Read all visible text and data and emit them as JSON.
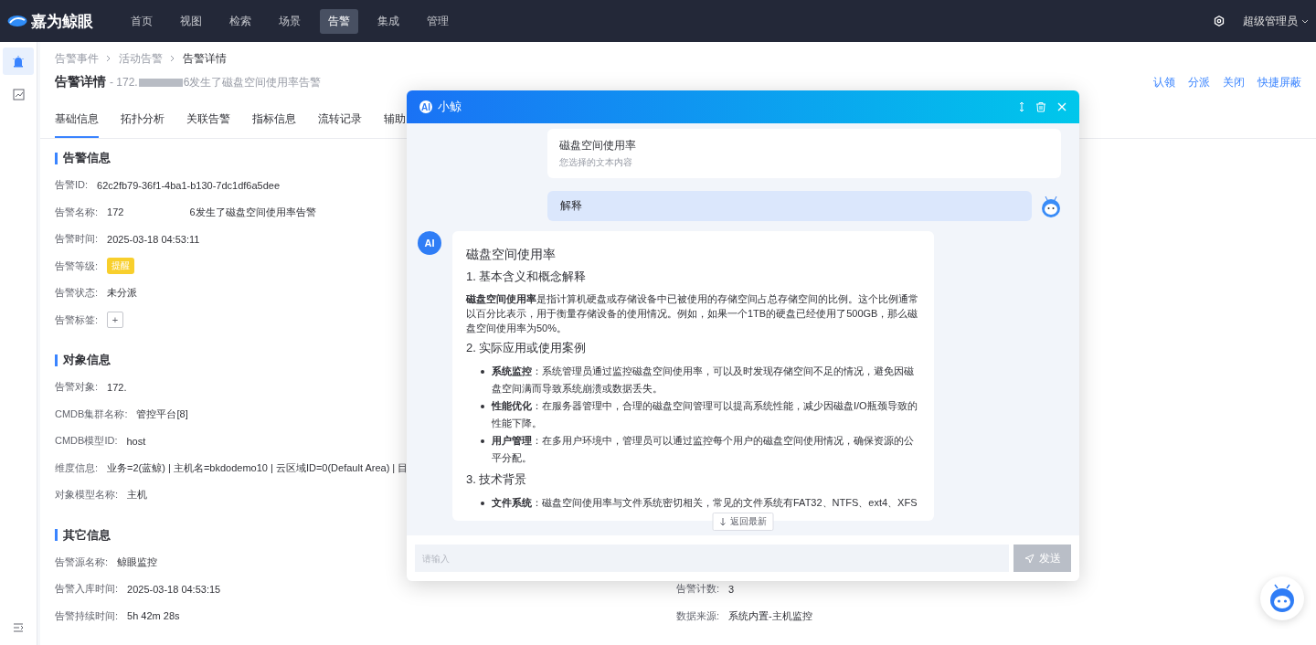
{
  "topbar": {
    "brand": "嘉为鲸眼",
    "nav": [
      {
        "label": "首页",
        "selected": false
      },
      {
        "label": "视图",
        "selected": false
      },
      {
        "label": "检索",
        "selected": false
      },
      {
        "label": "场景",
        "selected": false
      },
      {
        "label": "告警",
        "selected": true
      },
      {
        "label": "集成",
        "selected": false
      },
      {
        "label": "管理",
        "selected": false
      }
    ],
    "user": "超级管理员"
  },
  "sidebar": {
    "items": [
      {
        "kind": "alarm",
        "selected": true
      },
      {
        "kind": "chart",
        "selected": false
      }
    ]
  },
  "breadcrumb": [
    "告警事件",
    "活动告警",
    "告警详情"
  ],
  "header": {
    "title": "告警详情",
    "subtitle_prefix": "- 172.",
    "subtitle_suffix": "6发生了磁盘空间使用率告警",
    "actions": [
      "认领",
      "分派",
      "关闭",
      "快捷屏蔽"
    ]
  },
  "tabs": [
    {
      "label": "基础信息",
      "selected": true
    },
    {
      "label": "拓扑分析",
      "selected": false
    },
    {
      "label": "关联告警",
      "selected": false
    },
    {
      "label": "指标信息",
      "selected": false
    },
    {
      "label": "流转记录",
      "selected": false
    },
    {
      "label": "辅助",
      "selected": false
    }
  ],
  "sections": [
    {
      "title": "告警信息",
      "rows": [
        [
          {
            "label": "告警ID:",
            "value": "62c2fb79-36f1-4ba1-b130-7dc1df6a5dee",
            "kind": "text"
          }
        ],
        [
          {
            "label": "告警名称:",
            "value": "172",
            "value_suffix": "6发生了磁盘空间使用率告警",
            "kind": "redacted"
          }
        ],
        [
          {
            "label": "告警时间:",
            "value": "2025-03-18 04:53:11",
            "kind": "text"
          }
        ],
        [
          {
            "label": "告警等级:",
            "value": "提醒",
            "kind": "badge"
          }
        ],
        [
          {
            "label": "告警状态:",
            "value": "未分派",
            "kind": "text"
          }
        ],
        [
          {
            "label": "告警标签:",
            "value": "+",
            "kind": "add"
          }
        ]
      ]
    },
    {
      "title": "对象信息",
      "rows": [
        [
          {
            "label": "告警对象:",
            "value": "172.",
            "kind": "redacted"
          }
        ],
        [
          {
            "label": "CMDB集群名称:",
            "value": "管控平台[8]",
            "kind": "text"
          }
        ],
        [
          {
            "label": "CMDB模型ID:",
            "value": "host",
            "kind": "text"
          }
        ],
        [
          {
            "label": "维度信息:",
            "value": "业务=2(蓝鲸) | 主机名=bkdodemo10 | 云区域ID=0(Default Area) | 目",
            "kind": "text"
          }
        ],
        [
          {
            "label": "对象模型名称:",
            "value": "主机",
            "kind": "text"
          }
        ]
      ]
    },
    {
      "title": "其它信息",
      "rows": [
        [
          {
            "label": "告警源名称:",
            "value": "鲸眼监控",
            "kind": "text"
          }
        ],
        [
          {
            "label": "告警入库时间:",
            "value": "2025-03-18 04:53:15",
            "kind": "text"
          },
          {
            "label": "告警计数:",
            "value": "3",
            "kind": "text"
          }
        ],
        [
          {
            "label": "告警持续时间:",
            "value": "5h 42m 28s",
            "kind": "text"
          },
          {
            "label": "数据来源:",
            "value": "系统内置-主机监控",
            "kind": "text"
          }
        ]
      ]
    }
  ],
  "chat": {
    "logo": "AI",
    "answer_avatar": "AI",
    "title": "小鲸",
    "quote": {
      "text": "磁盘空间使用率",
      "hint": "您选择的文本内容"
    },
    "question": "解释",
    "answer": {
      "title": "磁盘空间使用率",
      "sections": [
        {
          "heading": "1. 基本含义和概念解释",
          "paragraph": "**磁盘空间使用率**是指计算机硬盘或存储设备中已被使用的存储空间占总存储空间的比例。这个比例通常以百分比表示，用于衡量存储设备的使用情况。例如，如果一个1TB的硬盘已经使用了500GB，那么磁盘空间使用率为50%。"
        },
        {
          "heading": "2. 实际应用或使用案例",
          "bullets": [
            "**系统监控**：系统管理员通过监控磁盘空间使用率，可以及时发现存储空间不足的情况，避免因磁盘空间满而导致系统崩溃或数据丢失。",
            "**性能优化**：在服务器管理中，合理的磁盘空间管理可以提高系统性能，减少因磁盘I/O瓶颈导致的性能下降。",
            "**用户管理**：在多用户环境中，管理员可以通过监控每个用户的磁盘空间使用情况，确保资源的公平分配。"
          ]
        },
        {
          "heading": "3. 技术背景",
          "bullets": [
            "**文件系统**：磁盘空间使用率与文件系统密切相关，常见的文件系统有FAT32、NTFS、ext4、XFS"
          ]
        }
      ]
    },
    "back_to_latest": "返回最新",
    "input_placeholder": "请输入",
    "send": "发送"
  }
}
